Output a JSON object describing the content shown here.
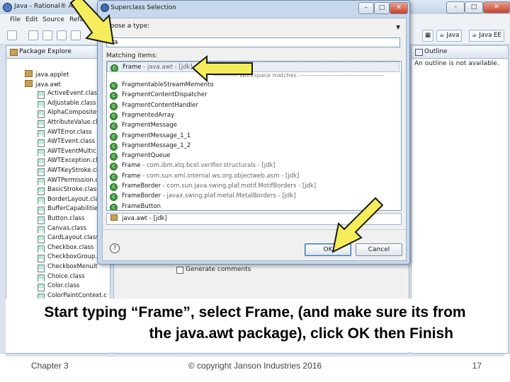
{
  "eclipse": {
    "title": "Java - Rational® A",
    "menu": [
      "File",
      "Edit",
      "Source",
      "Refa"
    ],
    "package_explorer_tab": "Package Explore",
    "outline_tab": "Outline",
    "outline_message": "An outline is not available.",
    "perspectives": [
      "Java",
      "Java EE"
    ],
    "tree": [
      {
        "kind": "package",
        "label": "java.applet"
      },
      {
        "kind": "package",
        "label": "java.awt"
      },
      {
        "kind": "class",
        "label": "ActiveEvent.class"
      },
      {
        "kind": "class",
        "label": "Adjustable.class"
      },
      {
        "kind": "class",
        "label": "AlphaComposite"
      },
      {
        "kind": "class",
        "label": "AttributeValue.cl"
      },
      {
        "kind": "class",
        "label": "AWTError.class"
      },
      {
        "kind": "class",
        "label": "AWTEvent.class"
      },
      {
        "kind": "class",
        "label": "AWTEventMultic"
      },
      {
        "kind": "class",
        "label": "AWTException.cl"
      },
      {
        "kind": "class",
        "label": "AWTKeyStroke.cl"
      },
      {
        "kind": "class",
        "label": "AWTPermission.c"
      },
      {
        "kind": "class",
        "label": "BasicStroke.class"
      },
      {
        "kind": "class",
        "label": "BorderLayout.cla"
      },
      {
        "kind": "class",
        "label": "BufferCapabilitie"
      },
      {
        "kind": "class",
        "label": "Button.class"
      },
      {
        "kind": "class",
        "label": "Canvas.class"
      },
      {
        "kind": "class",
        "label": "CardLayout.class"
      },
      {
        "kind": "class",
        "label": "Checkbox.class"
      },
      {
        "kind": "class",
        "label": "CheckboxGroup.c"
      },
      {
        "kind": "class",
        "label": "CheckboxMenuIt"
      },
      {
        "kind": "class",
        "label": "Choice.class"
      },
      {
        "kind": "class",
        "label": "Color.class"
      },
      {
        "kind": "class",
        "label": "ColorPaintContext.c"
      }
    ],
    "generate_comments": "Generate comments"
  },
  "dialog": {
    "title": "Superclass Selection",
    "choose_label": "hoose a type:",
    "input_value": "fra",
    "matching_label": "Matching items:",
    "workspace_separator": "------------ Workspace matches ------------------------------------------",
    "results": [
      {
        "name": "Frame",
        "qualifier": " - java.awt - [jdk]",
        "selected": true
      },
      {
        "name": "FragmentableStreamMemento",
        "qualifier": ""
      },
      {
        "name": "FragmentContentDispatcher",
        "qualifier": ""
      },
      {
        "name": "FragmentContentHandler",
        "qualifier": ""
      },
      {
        "name": "FragmentedArray",
        "qualifier": ""
      },
      {
        "name": "FragmentMessage",
        "qualifier": ""
      },
      {
        "name": "FragmentMessage_1_1",
        "qualifier": ""
      },
      {
        "name": "FragmentMessage_1_2",
        "qualifier": ""
      },
      {
        "name": "FragmentQueue",
        "qualifier": ""
      },
      {
        "name": "Frame",
        "qualifier": " - com.ibm.xtq.bcel.verifier.structurals - [jdk]"
      },
      {
        "name": "Frame",
        "qualifier": " - com.sun.xml.internal.ws.org.objectweb.asm - [jdk]"
      },
      {
        "name": "FrameBorder",
        "qualifier": " - com.sun.java.swing.plaf.motif.MotifBorders - [jdk]"
      },
      {
        "name": "FrameBorder",
        "qualifier": " - javax.swing.plaf.metal.MetalBorders - [jdk]"
      },
      {
        "name": "FrameButton",
        "qualifier": ""
      }
    ],
    "package_field": "java.awt - [jdk]",
    "ok_label": "OK",
    "cancel_label": "Cancel",
    "help_glyph": "?"
  },
  "caption": {
    "line1": "Start typing “Frame”, select Frame, (and make sure its from",
    "line2": "the java.awt package), click OK then Finish"
  },
  "footer": {
    "left": "Chapter 3",
    "center": "© copyright Janson Industries 2016",
    "page": "17"
  },
  "colors": {
    "arrow_fill": "#f4ec5b",
    "arrow_stroke": "#1a1a1a",
    "selection_border": "#7a8fa8",
    "ok_focus": "#3a6fb5"
  }
}
